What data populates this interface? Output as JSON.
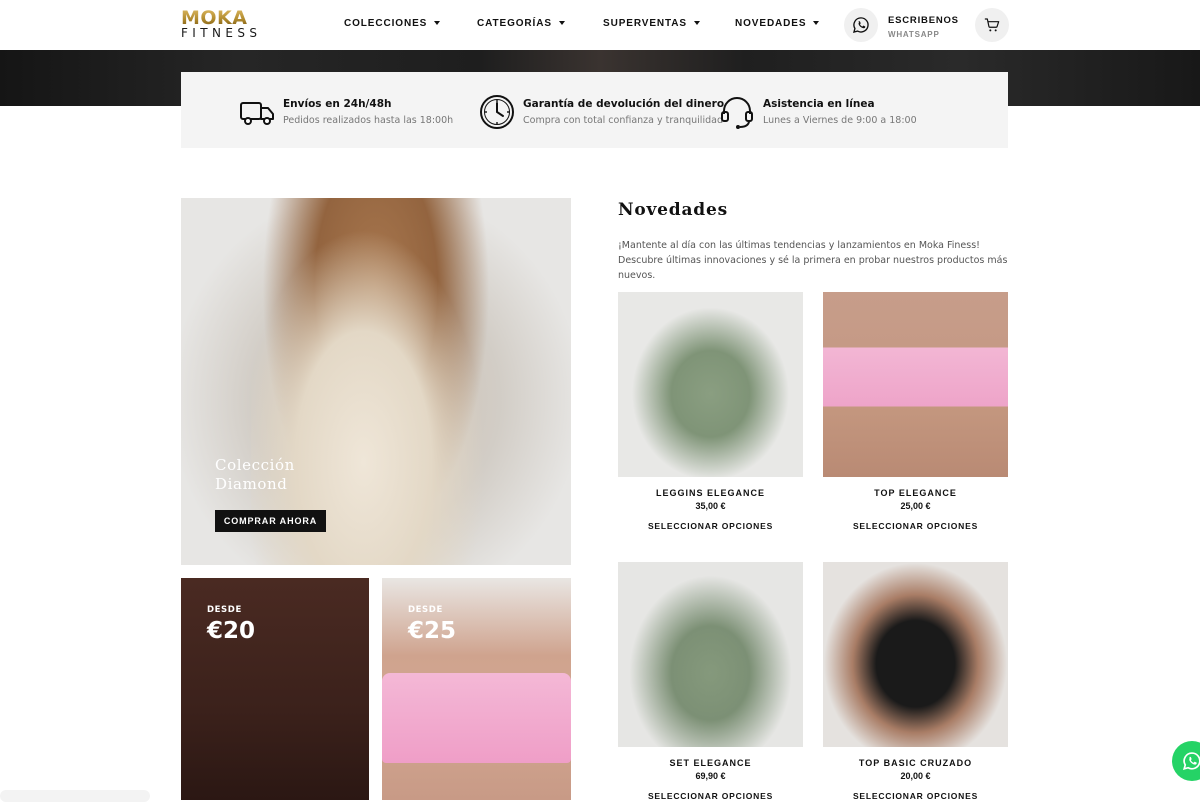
{
  "header": {
    "logo_top": "MOKA",
    "logo_bottom": "FITNESS",
    "nav": [
      {
        "label": "COLECCIONES"
      },
      {
        "label": "CATEGORÍAS"
      },
      {
        "label": "SUPERVENTAS"
      },
      {
        "label": "NOVEDADES"
      }
    ],
    "whatsapp_title": "ESCRIBENOS",
    "whatsapp_sub": "WHATSAPP"
  },
  "features": [
    {
      "title": "Envíos en 24h/48h",
      "subtitle": "Pedidos realizados hasta las 18:00h",
      "icon": "truck-icon"
    },
    {
      "title": "Garantía de devolución del dinero",
      "subtitle": "Compra con total confianza y tranquilidad",
      "icon": "clock-icon"
    },
    {
      "title": "Asistencia en línea",
      "subtitle": "Lunes a Viernes de 9:00 a 18:00",
      "icon": "headset-icon"
    }
  ],
  "hero": {
    "title_line1": "Colección",
    "title_line2": "Diamond",
    "button": "COMPRAR AHORA"
  },
  "promos": [
    {
      "label": "DESDE",
      "price": "€20"
    },
    {
      "label": "DESDE",
      "price": "€25"
    }
  ],
  "novedades": {
    "title": "Novedades",
    "desc_line1": "¡Mantente al día con las últimas tendencias y lanzamientos en Moka Finess!",
    "desc_line2": "Descubre últimas innovaciones y sé la primera en probar nuestros productos más nuevos.",
    "products": [
      {
        "name": "LEGGINS ELEGANCE",
        "price": "35,00 €",
        "action": "SELECCIONAR OPCIONES"
      },
      {
        "name": "TOP ELEGANCE",
        "price": "25,00 €",
        "action": "SELECCIONAR OPCIONES"
      },
      {
        "name": "SET ELEGANCE",
        "price": "69,90 €",
        "action": "SELECCIONAR OPCIONES"
      },
      {
        "name": "TOP BASIC CRUZADO",
        "price": "20,00 €",
        "action": "SELECCIONAR OPCIONES"
      }
    ]
  },
  "colors": {
    "accent_gold": "#b08a2d",
    "whatsapp_green": "#25d366",
    "button_dark": "#111111"
  }
}
